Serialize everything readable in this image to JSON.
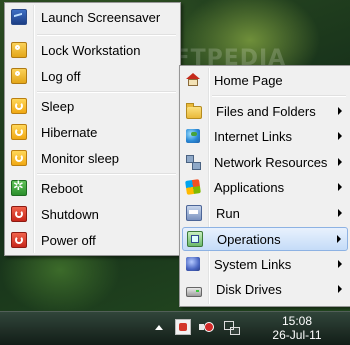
{
  "watermark": "SOFTPEDIA",
  "left_menu": {
    "items": [
      {
        "label": "Launch Screensaver",
        "icon": "screensaver-icon"
      },
      {
        "label": "Lock Workstation",
        "icon": "key-icon"
      },
      {
        "label": "Log off",
        "icon": "key-icon"
      },
      {
        "label": "Sleep",
        "icon": "power-icon"
      },
      {
        "label": "Hibernate",
        "icon": "power-icon"
      },
      {
        "label": "Monitor sleep",
        "icon": "power-icon"
      },
      {
        "label": "Reboot",
        "icon": "reboot-icon"
      },
      {
        "label": "Shutdown",
        "icon": "power-red-icon"
      },
      {
        "label": "Power off",
        "icon": "power-red-icon"
      }
    ]
  },
  "right_menu": {
    "items": [
      {
        "label": "Home Page",
        "icon": "home-icon",
        "submenu": false
      },
      {
        "label": "Files and Folders",
        "icon": "folder-icon",
        "submenu": true
      },
      {
        "label": "Internet Links",
        "icon": "globe-icon",
        "submenu": true
      },
      {
        "label": "Network Resources",
        "icon": "network-icon",
        "submenu": true
      },
      {
        "label": "Applications",
        "icon": "windows-icon",
        "submenu": true
      },
      {
        "label": "Run",
        "icon": "run-icon",
        "submenu": true
      },
      {
        "label": "Operations",
        "icon": "operations-icon",
        "submenu": true,
        "selected": true
      },
      {
        "label": "System Links",
        "icon": "system-links-icon",
        "submenu": true
      },
      {
        "label": "Disk Drives",
        "icon": "drive-icon",
        "submenu": true
      }
    ]
  },
  "taskbar": {
    "time": "15:08",
    "date": "26-Jul-11"
  },
  "colors": {
    "menu_bg": "#f0f0f0",
    "selection_border": "#8db2e3",
    "taskbar": "#1a2820"
  }
}
